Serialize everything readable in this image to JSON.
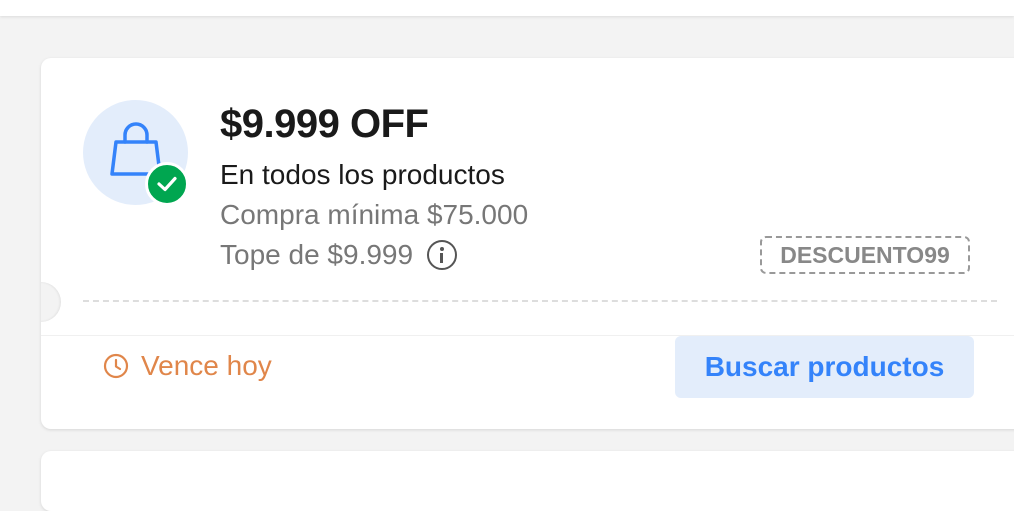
{
  "coupon": {
    "title": "$9.999 OFF",
    "subtitle": "En todos los productos",
    "min_purchase": "Compra mínima $75.000",
    "cap": "Tope de $9.999",
    "code": "DESCUENTO99",
    "expiry": "Vence hoy",
    "action_label": "Buscar productos",
    "icon": "shopping-bag-icon",
    "badge_icon": "check-icon",
    "info_icon": "info-icon",
    "clock_icon": "clock-icon"
  },
  "colors": {
    "accent": "#3483fa",
    "accent_bg": "#e3edfb",
    "success": "#00a650",
    "warning": "#e0864a",
    "muted": "#777777"
  }
}
